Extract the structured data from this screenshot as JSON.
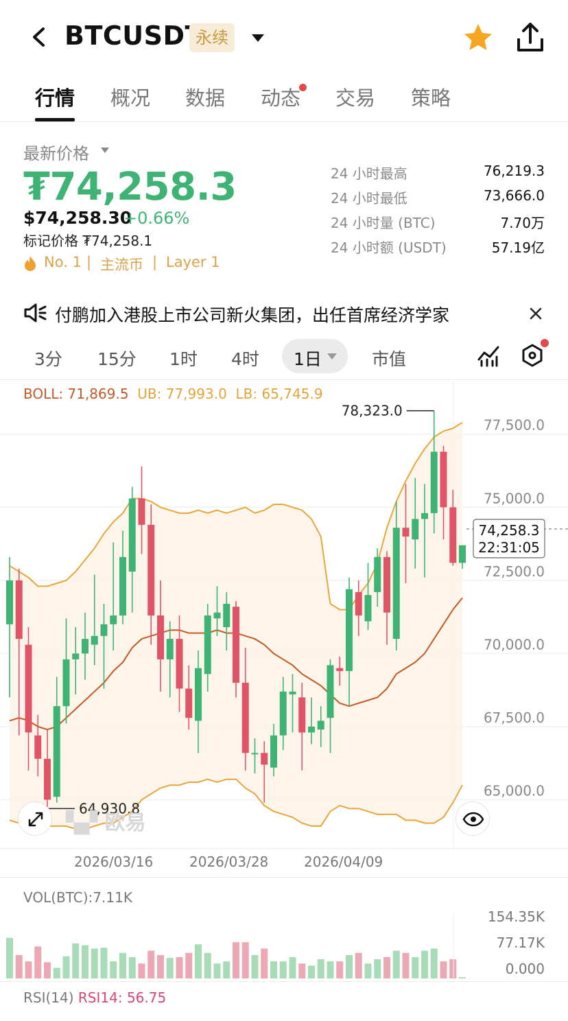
{
  "header": {
    "symbol": "BTCUSDT",
    "badge": "永续"
  },
  "tabs": [
    {
      "label": "行情",
      "active": true
    },
    {
      "label": "概况"
    },
    {
      "label": "数据"
    },
    {
      "label": "动态",
      "dot": true
    },
    {
      "label": "交易"
    },
    {
      "label": "策略"
    }
  ],
  "price": {
    "label": "最新价格",
    "last": "₮74,258.3",
    "usd": "$74,258.30",
    "change": "+0.66%",
    "mark_label": "标记价格",
    "mark": "₮74,258.1",
    "tags": [
      "No. 1",
      "|",
      "主流币",
      "|",
      "Layer 1"
    ],
    "color_up": "#3fb374",
    "color_down": "#e05565"
  },
  "stats": [
    {
      "label": "24 小时最高",
      "value": "76,219.3"
    },
    {
      "label": "24 小时最低",
      "value": "73,666.0"
    },
    {
      "label": "24 小时量 (BTC)",
      "value": "7.70万"
    },
    {
      "label": "24 小时额 (USDT)",
      "value": "57.19亿"
    }
  ],
  "news": {
    "text": "付鹏加入港股上市公司新火集团，出任首席经济学家"
  },
  "intervals": [
    {
      "label": "3分"
    },
    {
      "label": "15分"
    },
    {
      "label": "1时"
    },
    {
      "label": "4时"
    },
    {
      "label": "1日",
      "selected": true
    },
    {
      "label": "市值"
    }
  ],
  "boll": {
    "mid": "BOLL: 71,869.5",
    "ub": "UB: 77,993.0",
    "lb": "LB: 65,745.9"
  },
  "watermark": "欧易",
  "chart_data": {
    "type": "candlestick",
    "y_ticks": [
      "77,500.0",
      "75,000.0",
      "72,500.0",
      "70,000.0",
      "67,500.0",
      "65,000.0"
    ],
    "ylim": [
      63300,
      79300
    ],
    "x_ticks": [
      "2026/03/16",
      "2026/03/28",
      "2026/04/09"
    ],
    "high_label": "78,323.0",
    "low_label": "64,930.8",
    "last_price_label": "74,258.3",
    "countdown": "22:31:05",
    "candles": [
      {
        "o": 71000,
        "c": 72500,
        "h": 73300,
        "l": 68500
      },
      {
        "o": 72500,
        "c": 70500,
        "h": 72900,
        "l": 67200
      },
      {
        "o": 70300,
        "c": 67300,
        "h": 70900,
        "l": 66000
      },
      {
        "o": 67200,
        "c": 66400,
        "h": 67900,
        "l": 65800
      },
      {
        "o": 66400,
        "c": 65000,
        "h": 67400,
        "l": 64700
      },
      {
        "o": 65100,
        "c": 68200,
        "h": 69200,
        "l": 64900
      },
      {
        "o": 68200,
        "c": 69800,
        "h": 71200,
        "l": 67600
      },
      {
        "o": 69800,
        "c": 70000,
        "h": 70900,
        "l": 68600
      },
      {
        "o": 70000,
        "c": 70500,
        "h": 71400,
        "l": 69100
      },
      {
        "o": 70300,
        "c": 70600,
        "h": 72700,
        "l": 69600
      },
      {
        "o": 70600,
        "c": 71000,
        "h": 71700,
        "l": 68800
      },
      {
        "o": 71000,
        "c": 71300,
        "h": 73800,
        "l": 70100
      },
      {
        "o": 71300,
        "c": 73300,
        "h": 74200,
        "l": 71000
      },
      {
        "o": 72800,
        "c": 75300,
        "h": 75700,
        "l": 71400
      },
      {
        "o": 75300,
        "c": 74400,
        "h": 76400,
        "l": 73400
      },
      {
        "o": 74400,
        "c": 71300,
        "h": 75100,
        "l": 70300
      },
      {
        "o": 71300,
        "c": 69800,
        "h": 72500,
        "l": 68700
      },
      {
        "o": 69800,
        "c": 70500,
        "h": 71100,
        "l": 68500
      },
      {
        "o": 70500,
        "c": 68800,
        "h": 71300,
        "l": 68000
      },
      {
        "o": 68800,
        "c": 67800,
        "h": 69600,
        "l": 67400
      },
      {
        "o": 67700,
        "c": 69500,
        "h": 70100,
        "l": 66600
      },
      {
        "o": 69300,
        "c": 71300,
        "h": 71700,
        "l": 68700
      },
      {
        "o": 71200,
        "c": 71400,
        "h": 72300,
        "l": 70600
      },
      {
        "o": 70900,
        "c": 71700,
        "h": 72100,
        "l": 70100
      },
      {
        "o": 71600,
        "c": 69000,
        "h": 71800,
        "l": 68500
      },
      {
        "o": 69000,
        "c": 66600,
        "h": 70200,
        "l": 66000
      },
      {
        "o": 66600,
        "c": 66600,
        "h": 67100,
        "l": 65900
      },
      {
        "o": 66600,
        "c": 66200,
        "h": 67000,
        "l": 64900
      },
      {
        "o": 66100,
        "c": 67200,
        "h": 67600,
        "l": 65800
      },
      {
        "o": 67200,
        "c": 68700,
        "h": 69200,
        "l": 66700
      },
      {
        "o": 68600,
        "c": 68700,
        "h": 69300,
        "l": 67300
      },
      {
        "o": 68500,
        "c": 67300,
        "h": 69000,
        "l": 66000
      },
      {
        "o": 67300,
        "c": 67500,
        "h": 68500,
        "l": 66900
      },
      {
        "o": 67400,
        "c": 67700,
        "h": 68200,
        "l": 66800
      },
      {
        "o": 67800,
        "c": 69600,
        "h": 69800,
        "l": 66600
      },
      {
        "o": 69500,
        "c": 69400,
        "h": 69900,
        "l": 68900
      },
      {
        "o": 69400,
        "c": 72200,
        "h": 72600,
        "l": 68200
      },
      {
        "o": 72100,
        "c": 71300,
        "h": 72500,
        "l": 70600
      },
      {
        "o": 71100,
        "c": 72000,
        "h": 73100,
        "l": 70800
      },
      {
        "o": 72100,
        "c": 73300,
        "h": 73600,
        "l": 71600
      },
      {
        "o": 73300,
        "c": 71400,
        "h": 73500,
        "l": 70300
      },
      {
        "o": 70500,
        "c": 74300,
        "h": 75200,
        "l": 70100
      },
      {
        "o": 74300,
        "c": 74000,
        "h": 75800,
        "l": 72400
      },
      {
        "o": 73900,
        "c": 74600,
        "h": 76000,
        "l": 72900
      },
      {
        "o": 74600,
        "c": 74800,
        "h": 75800,
        "l": 72600
      },
      {
        "o": 74800,
        "c": 76900,
        "h": 78300,
        "l": 74100
      },
      {
        "o": 76900,
        "c": 75000,
        "h": 77100,
        "l": 73900
      },
      {
        "o": 75000,
        "c": 73100,
        "h": 75600,
        "l": 73000
      },
      {
        "o": 73100,
        "c": 73700,
        "h": 73700,
        "l": 72900
      }
    ],
    "ub": [
      73000,
      72800,
      72600,
      72300,
      72300,
      72400,
      72500,
      72800,
      73200,
      73600,
      74100,
      74500,
      74800,
      75300,
      75300,
      75200,
      75000,
      74900,
      74800,
      74800,
      74900,
      74800,
      74900,
      74800,
      74900,
      75000,
      74800,
      74900,
      75100,
      75100,
      75000,
      74900,
      74600,
      74000,
      71700,
      71500,
      71500,
      72000,
      72400,
      73100,
      74300,
      75200,
      75900,
      76500,
      77000,
      77400,
      77600,
      77700,
      77900
    ],
    "mid": [
      67700,
      67800,
      67700,
      67500,
      67400,
      67500,
      67800,
      68100,
      68400,
      68700,
      69000,
      69400,
      69700,
      70200,
      70500,
      70600,
      70700,
      70800,
      70800,
      70700,
      70700,
      70700,
      70800,
      70700,
      70700,
      70600,
      70500,
      70300,
      70000,
      69800,
      69600,
      69300,
      69100,
      68900,
      68600,
      68300,
      68200,
      68300,
      68400,
      68500,
      68800,
      69300,
      69500,
      69700,
      70000,
      70500,
      71000,
      71500,
      71900
    ],
    "lb": [
      64300,
      64200,
      64200,
      64100,
      64100,
      64100,
      64100,
      64000,
      64000,
      64100,
      64200,
      64200,
      64400,
      64600,
      65000,
      65200,
      65400,
      65500,
      65500,
      65600,
      65600,
      65700,
      65600,
      65700,
      65700,
      65400,
      65200,
      64800,
      64600,
      64500,
      64400,
      64200,
      64100,
      64100,
      64600,
      64800,
      64700,
      64700,
      64600,
      64500,
      64500,
      64500,
      64300,
      64300,
      64200,
      64200,
      64400,
      64900,
      65500
    ]
  },
  "volume": {
    "label": "VOL(BTC):7.11K",
    "axis": [
      "154.35K",
      "77.17K",
      "0.000"
    ],
    "ylim": [
      0,
      154350
    ],
    "values": [
      95000,
      55000,
      40000,
      75000,
      38000,
      25000,
      52000,
      82000,
      78000,
      70000,
      72000,
      40000,
      60000,
      50000,
      35000,
      65000,
      55000,
      48000,
      50000,
      60000,
      80000,
      60000,
      35000,
      40000,
      85000,
      85000,
      55000,
      70000,
      40000,
      40000,
      50000,
      35000,
      30000,
      45000,
      40000,
      40000,
      55000,
      60000,
      35000,
      45000,
      50000,
      65000,
      60000,
      50000,
      65000,
      70000,
      40000,
      45000,
      3000
    ],
    "up_color": "#a8dcb6",
    "down_color": "#eda8b6"
  },
  "rsi": {
    "label": "RSI(14)",
    "value": "RSI14: 56.75"
  }
}
